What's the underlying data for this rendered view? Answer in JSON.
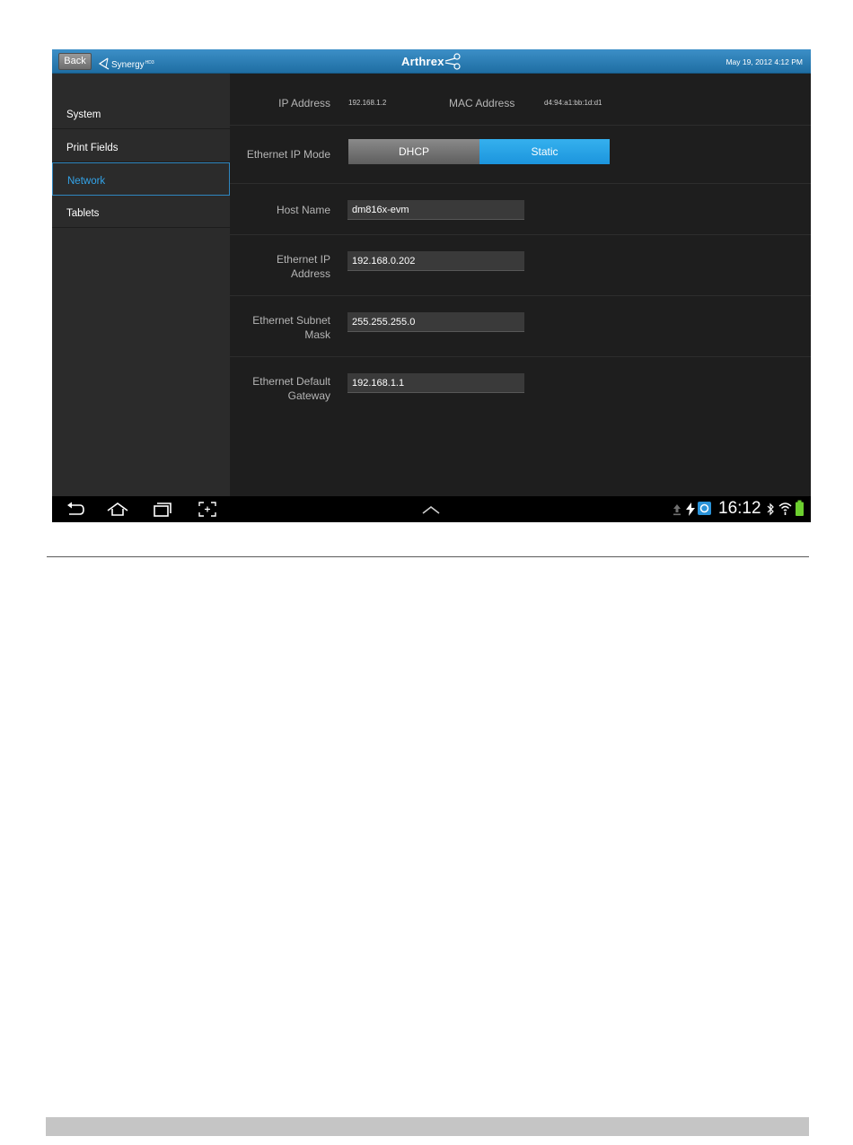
{
  "topbar": {
    "back_label": "Back",
    "app_name": "Synergy",
    "app_sup": "HD3",
    "brand": "Arthrex",
    "datetime": "May 19, 2012   4:12 PM"
  },
  "sidebar": {
    "items": [
      {
        "label": "System"
      },
      {
        "label": "Print Fields"
      },
      {
        "label": "Network"
      },
      {
        "label": "Tablets"
      }
    ],
    "active": "Network"
  },
  "network": {
    "ip_label": "IP Address",
    "ip_value": "192.168.1.2",
    "mac_label": "MAC Address",
    "mac_value": "d4:94:a1:bb:1d:d1",
    "mode_label": "Ethernet IP Mode",
    "mode_dhcp": "DHCP",
    "mode_static": "Static",
    "mode_selected": "Static",
    "host_label": "Host Name",
    "host_value": "dm816x-evm",
    "eip_label_1": "Ethernet IP",
    "eip_label_2": "Address",
    "eip_value": "192.168.0.202",
    "mask_label_1": "Ethernet Subnet",
    "mask_label_2": "Mask",
    "mask_value": "255.255.255.0",
    "gw_label_1": "Ethernet Default",
    "gw_label_2": "Gateway",
    "gw_value": "192.168.1.1"
  },
  "statusbar": {
    "clock": "16:12",
    "icons": [
      "usb-upload-icon",
      "usb-debug-icon",
      "sync-app-icon",
      "bluetooth-icon",
      "wifi-icon",
      "battery-icon"
    ]
  },
  "navbar": {
    "icons": [
      "back-nav-icon",
      "home-nav-icon",
      "recent-apps-icon",
      "screenshot-icon",
      "chevron-up-icon"
    ]
  },
  "colors": {
    "accent": "#1c95dd",
    "topbar": "#2a7db5",
    "background": "#212121"
  }
}
